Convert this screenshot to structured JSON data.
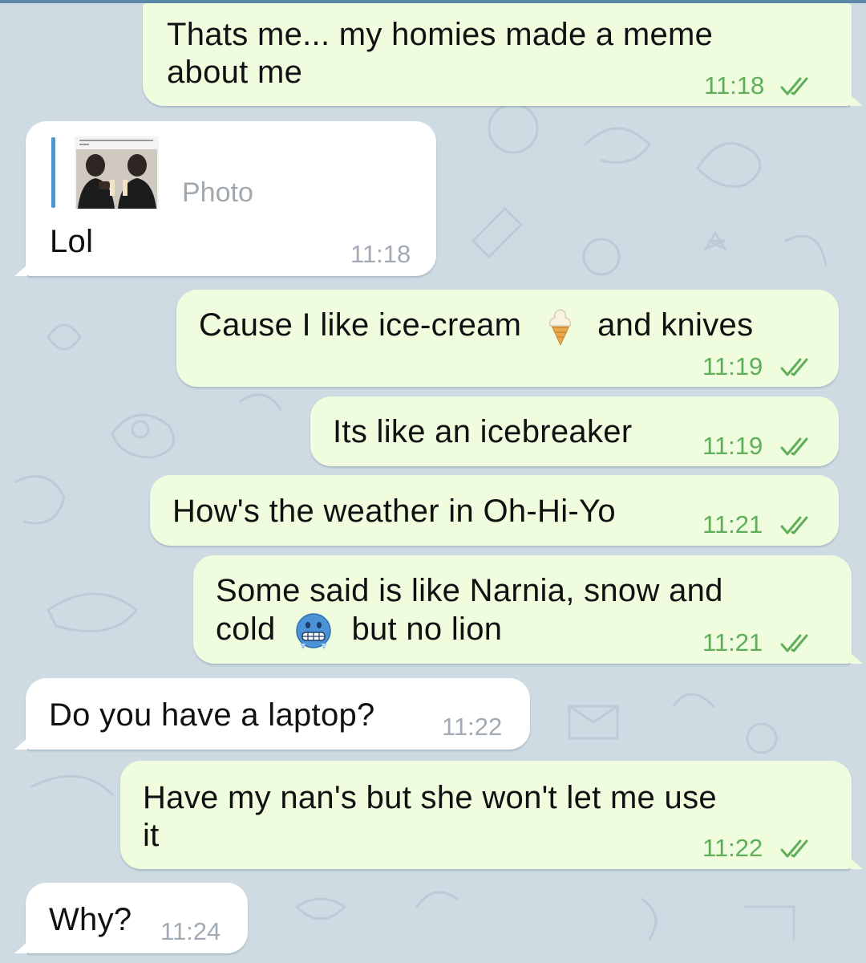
{
  "colors": {
    "background": "#cfdbe3",
    "outgoing_bubble": "#effdde",
    "incoming_bubble": "#ffffff",
    "outgoing_time": "#5eae5a",
    "incoming_time": "#a2abb3",
    "read_check": "#5eae5a",
    "reply_bar": "#4e96c9"
  },
  "messages": [
    {
      "direction": "out",
      "text_line1": "Thats me... my homies made a meme",
      "text_line2": "about me",
      "time": "11:18",
      "status": "read-double-check"
    },
    {
      "direction": "in",
      "reply": {
        "label": "Photo",
        "icon": "photo-thumbnail"
      },
      "text": "Lol",
      "time": "11:18"
    },
    {
      "direction": "out",
      "text_before": "Cause I like ice-cream",
      "emoji": "soft-ice-cream-emoji",
      "text_after": "and knives",
      "time": "11:19",
      "status": "read-double-check"
    },
    {
      "direction": "out",
      "text": "Its like an icebreaker",
      "time": "11:19",
      "status": "read-double-check"
    },
    {
      "direction": "out",
      "text": "How's the weather in Oh-Hi-Yo",
      "time": "11:21",
      "status": "read-double-check"
    },
    {
      "direction": "out",
      "text_line1": "Some said is like Narnia, snow and",
      "text_line2_before": "cold",
      "emoji": "cold-face-emoji",
      "text_line2_after": "but no lion",
      "time": "11:21",
      "status": "read-double-check"
    },
    {
      "direction": "in",
      "text": "Do you have a laptop?",
      "time": "11:22"
    },
    {
      "direction": "out",
      "text_line1": "Have my nan's but she won't let me use",
      "text_line2": "it",
      "time": "11:22",
      "status": "read-double-check"
    },
    {
      "direction": "in",
      "text": "Why?",
      "time": "11:24"
    }
  ]
}
